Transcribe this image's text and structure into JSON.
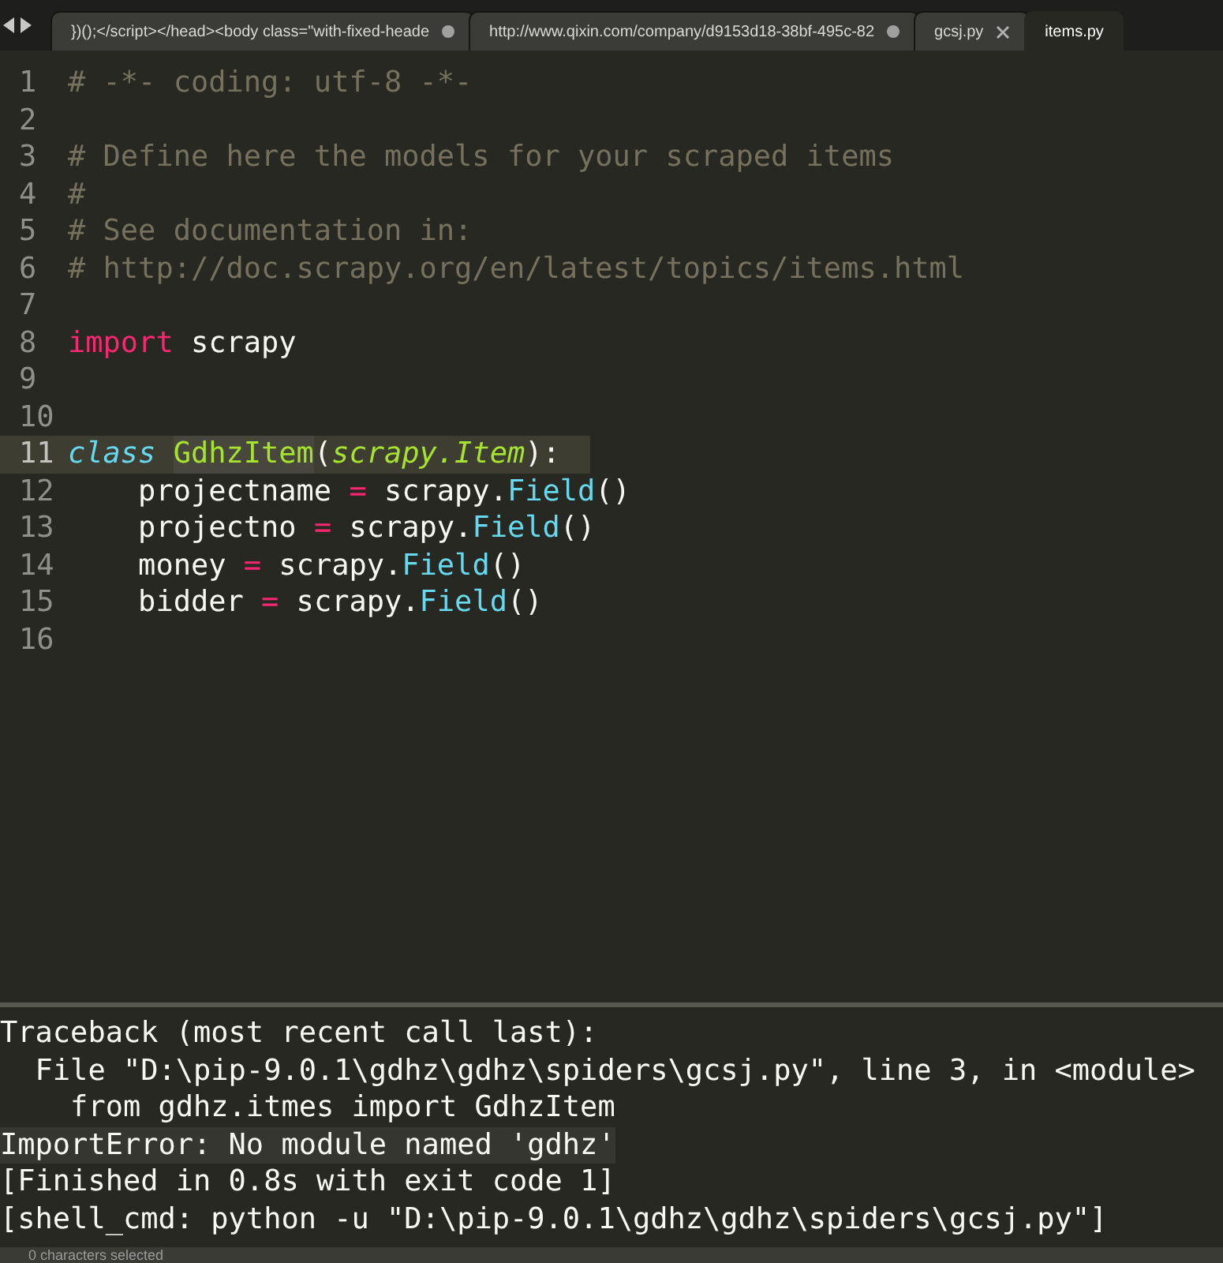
{
  "tabs": [
    {
      "label": "})();</script></head><body class=\"with-fixed-heade",
      "selected": false,
      "modified": true
    },
    {
      "label": "http://www.qixin.com/company/d9153d18-38bf-495c-82",
      "selected": false,
      "modified": true
    },
    {
      "label": "gcsj.py",
      "selected": false,
      "modified": false
    },
    {
      "label": "items.py",
      "selected": true,
      "modified": false
    }
  ],
  "editor": {
    "lines": [
      {
        "number": "1",
        "current": false,
        "tokens": [
          {
            "text": "# -*- coding: utf-8 -*-",
            "kind": "comment"
          }
        ]
      },
      {
        "number": "2",
        "current": false
      },
      {
        "number": "3",
        "current": false,
        "tokens": [
          {
            "text": "# Define here the models for your scraped items",
            "kind": "comment"
          }
        ]
      },
      {
        "number": "4",
        "current": false,
        "tokens": [
          {
            "text": "#",
            "kind": "comment"
          }
        ]
      },
      {
        "number": "5",
        "current": false,
        "tokens": [
          {
            "text": "# See documentation in:",
            "kind": "comment"
          }
        ]
      },
      {
        "number": "6",
        "current": false,
        "tokens": [
          {
            "text": "# http://doc.scrapy.org/en/latest/topics/items.html",
            "kind": "comment"
          }
        ]
      },
      {
        "number": "7",
        "current": false
      },
      {
        "number": "8",
        "current": false,
        "tokens": [
          {
            "text": "import",
            "kind": "keyword"
          },
          {
            "text": " scrapy",
            "kind": "plain"
          }
        ]
      },
      {
        "number": "9",
        "current": false
      },
      {
        "number": "10",
        "current": false
      },
      {
        "number": "11",
        "current": true,
        "tokens": [
          {
            "text": "class ",
            "kind": "storage"
          },
          {
            "text": "GdhzItem",
            "kind": "classname"
          },
          {
            "text": "(",
            "kind": "plain"
          },
          {
            "text": "scrapy.Item",
            "kind": "inherited"
          },
          {
            "text": "):",
            "kind": "plain"
          }
        ]
      },
      {
        "number": "12",
        "current": false,
        "tokens": [
          {
            "text": "    projectname ",
            "kind": "plain"
          },
          {
            "text": "=",
            "kind": "keyword"
          },
          {
            "text": " scrapy.",
            "kind": "plain"
          },
          {
            "text": "Field",
            "kind": "support"
          },
          {
            "text": "()",
            "kind": "plain"
          }
        ]
      },
      {
        "number": "13",
        "current": false,
        "tokens": [
          {
            "text": "    projectno ",
            "kind": "plain"
          },
          {
            "text": "=",
            "kind": "keyword"
          },
          {
            "text": " scrapy.",
            "kind": "plain"
          },
          {
            "text": "Field",
            "kind": "support"
          },
          {
            "text": "()",
            "kind": "plain"
          }
        ]
      },
      {
        "number": "14",
        "current": false,
        "tokens": [
          {
            "text": "    money ",
            "kind": "plain"
          },
          {
            "text": "=",
            "kind": "keyword"
          },
          {
            "text": " scrapy.",
            "kind": "plain"
          },
          {
            "text": "Field",
            "kind": "support"
          },
          {
            "text": "()",
            "kind": "plain"
          }
        ]
      },
      {
        "number": "15",
        "current": false,
        "tokens": [
          {
            "text": "    bidder ",
            "kind": "plain"
          },
          {
            "text": "=",
            "kind": "keyword"
          },
          {
            "text": " scrapy.",
            "kind": "plain"
          },
          {
            "text": "Field",
            "kind": "support"
          },
          {
            "text": "()",
            "kind": "plain"
          }
        ]
      },
      {
        "number": "16",
        "current": false
      }
    ]
  },
  "output": {
    "lines": [
      {
        "text": "Traceback (most recent call last):",
        "highlighted": false
      },
      {
        "text": "  File \"D:\\pip-9.0.1\\gdhz\\gdhz\\spiders\\gcsj.py\", line 3, in <module>",
        "highlighted": false
      },
      {
        "text": "    from gdhz.itmes import GdhzItem",
        "highlighted": false
      },
      {
        "text": "ImportError: No module named 'gdhz'",
        "highlighted": true
      },
      {
        "text": "[Finished in 0.8s with exit code 1]",
        "highlighted": false
      },
      {
        "text": "[shell_cmd: python -u \"D:\\pip-9.0.1\\gdhz\\gdhz\\spiders\\gcsj.py\"]",
        "highlighted": false
      }
    ]
  },
  "status_bar": {
    "text": "0 characters selected"
  }
}
